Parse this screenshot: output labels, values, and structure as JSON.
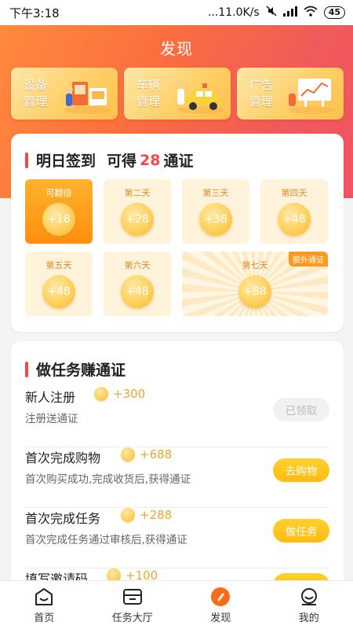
{
  "status_bar": {
    "time": "下午3:18",
    "network_speed": "...11.0K/s",
    "battery": "45"
  },
  "header": {
    "title": "发现"
  },
  "quick_links": [
    {
      "label_line1": "设备",
      "label_line2": "管理",
      "icon": "device-illustration"
    },
    {
      "label_line1": "车辆",
      "label_line2": "管理",
      "icon": "car-illustration"
    },
    {
      "label_line1": "广告",
      "label_line2": "管理",
      "icon": "ad-illustration"
    }
  ],
  "sign_in": {
    "title": "明日签到",
    "reward_prefix": "可得",
    "reward_amount": "28",
    "reward_suffix": "通证",
    "days": [
      {
        "label": "可翻倍",
        "value": "+18",
        "active": true
      },
      {
        "label": "第二天",
        "value": "+28"
      },
      {
        "label": "第三天",
        "value": "+38"
      },
      {
        "label": "第四天",
        "value": "+48"
      },
      {
        "label": "第五天",
        "value": "+48"
      },
      {
        "label": "第六天",
        "value": "+48"
      },
      {
        "label": "第七天",
        "value": "+88",
        "badge": "额外通证"
      }
    ]
  },
  "tasks": {
    "title": "做任务赚通证",
    "items": [
      {
        "name": "新人注册",
        "reward": "+300",
        "desc": "注册送通证",
        "button": "已领取",
        "done": true
      },
      {
        "name": "首次完成购物",
        "reward": "+688",
        "desc": "首次购买成功,完成收货后,获得通证",
        "button": "去购物",
        "done": false
      },
      {
        "name": "首次完成任务",
        "reward": "+288",
        "desc": "首次完成任务通过审核后,获得通证",
        "button": "做任务",
        "done": false
      },
      {
        "name": "填写邀请码",
        "reward": "+100",
        "desc": "",
        "button": "",
        "done": false
      }
    ]
  },
  "bottom_nav": [
    {
      "label": "首页",
      "icon": "home-icon"
    },
    {
      "label": "任务大厅",
      "icon": "task-hall-icon"
    },
    {
      "label": "发现",
      "icon": "discover-icon",
      "active": true
    },
    {
      "label": "我的",
      "icon": "profile-icon"
    }
  ],
  "colors": {
    "accent_red": "#ef4a4a",
    "accent_orange": "#ff8f0c",
    "coin_gold": "#f0a52a",
    "active_nav": "#ff6a1a"
  }
}
